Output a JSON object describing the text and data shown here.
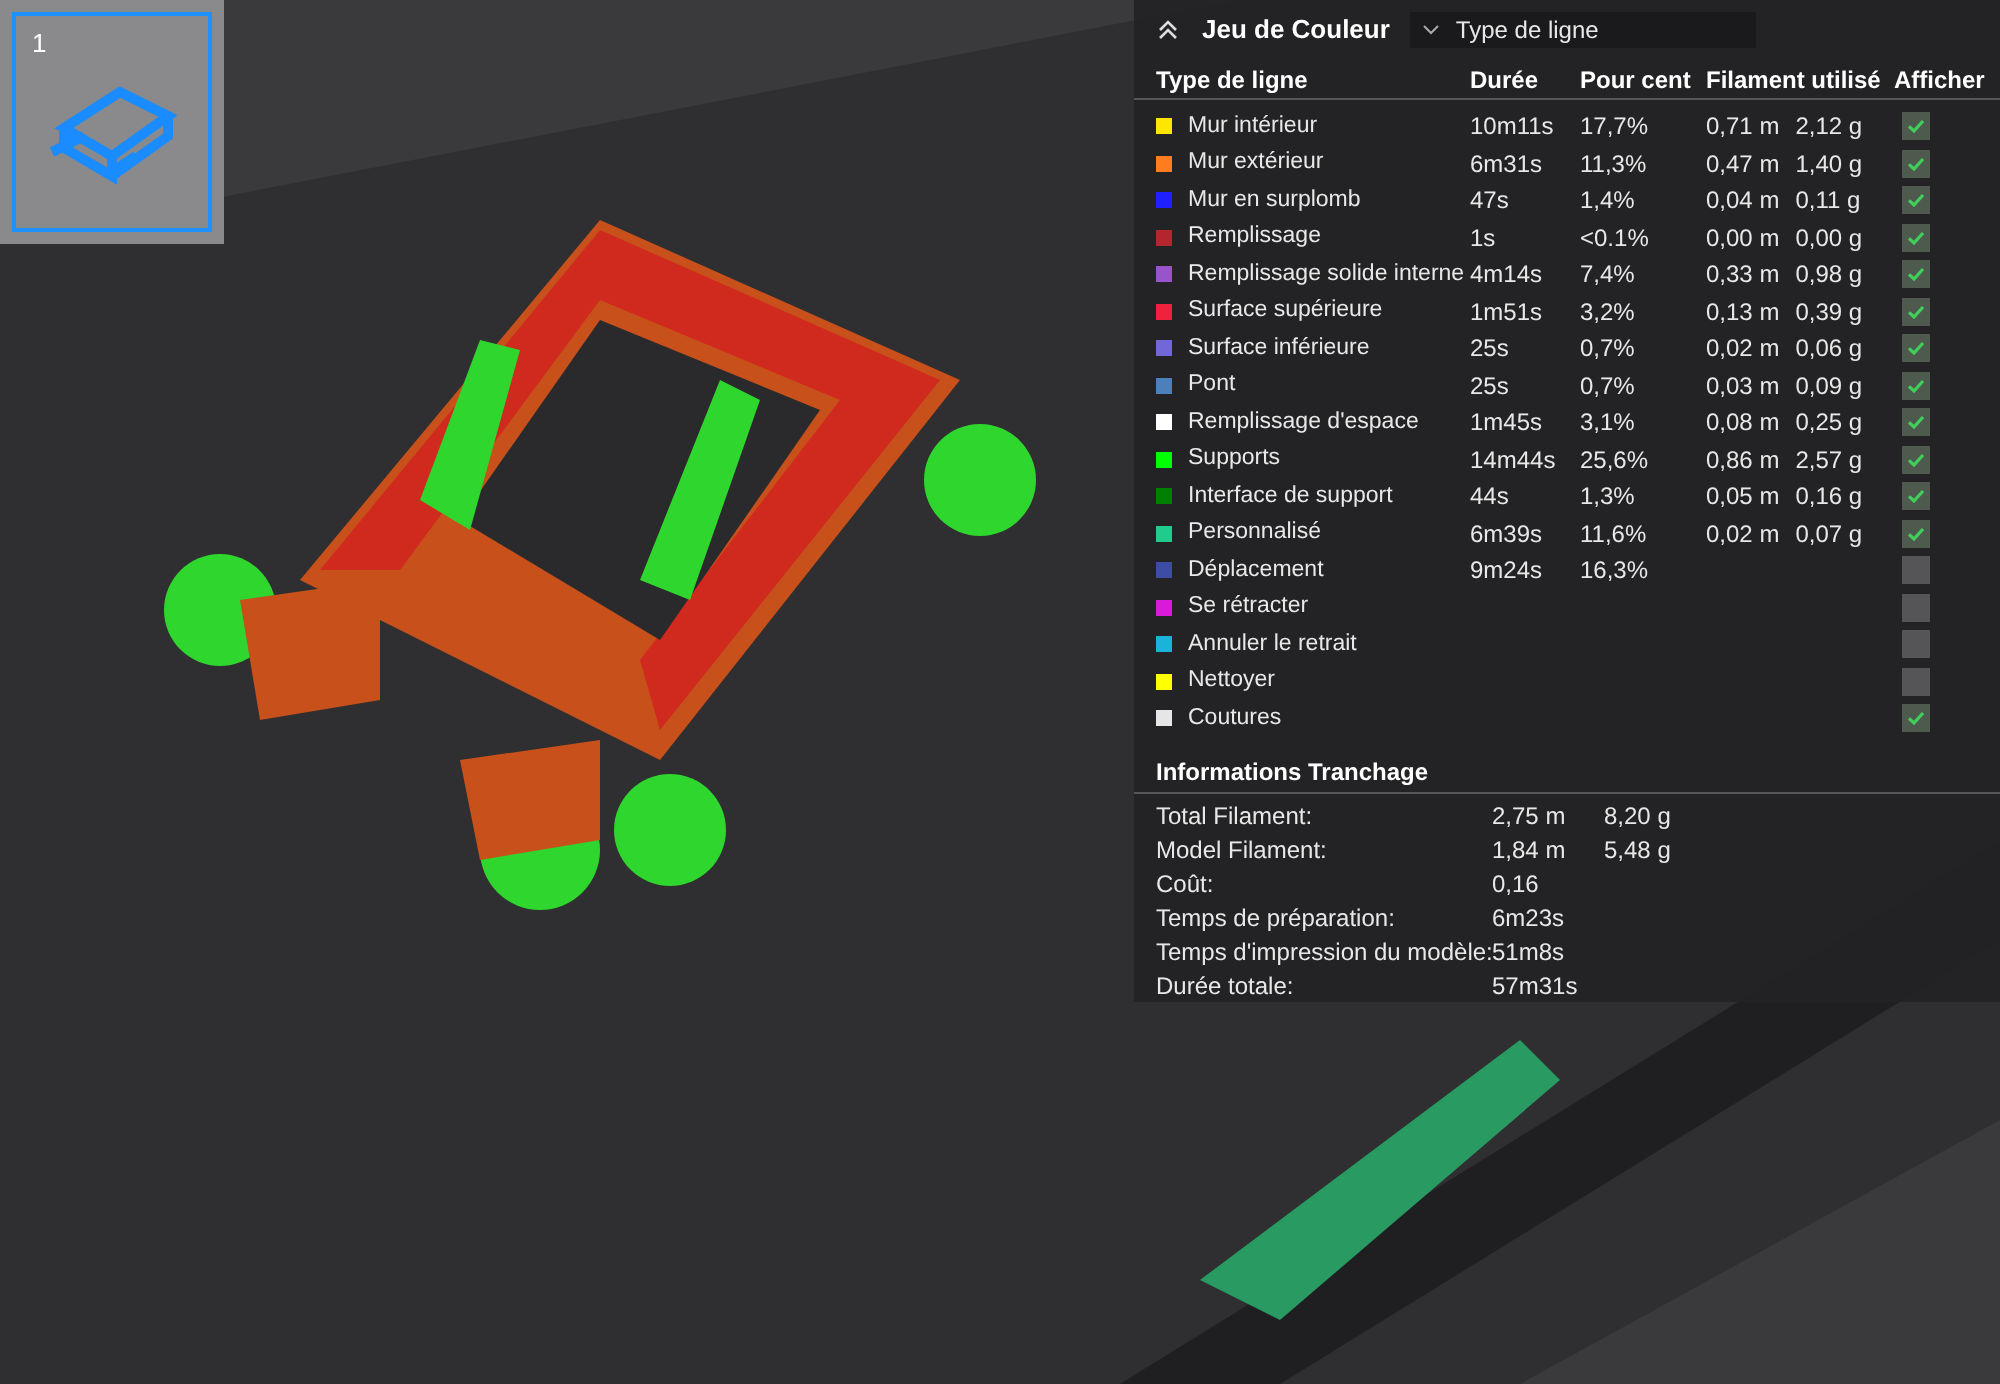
{
  "plate_thumbnail": {
    "label": "1",
    "selected": true
  },
  "legend": {
    "title": "Jeu de Couleur",
    "expanded": true,
    "view_select": {
      "value": "Type de ligne"
    },
    "columns": [
      "Type de ligne",
      "Durée",
      "Pour cent",
      "Filament utilisé",
      "Afficher"
    ],
    "rows": [
      {
        "name": "Mur intérieur",
        "color": "#ffe600",
        "duration": "10m11s",
        "percent": "17,7%",
        "length": "0,71 m",
        "weight": "2,12 g",
        "visible": true
      },
      {
        "name": "Mur extérieur",
        "color": "#ff7d1f",
        "duration": "6m31s",
        "percent": "11,3%",
        "length": "0,47 m",
        "weight": "1,40 g",
        "visible": true
      },
      {
        "name": "Mur en surplomb",
        "color": "#1f1fff",
        "duration": "47s",
        "percent": "1,4%",
        "length": "0,04 m",
        "weight": "0,11 g",
        "visible": true
      },
      {
        "name": "Remplissage",
        "color": "#b3262e",
        "duration": "1s",
        "percent": "<0.1%",
        "length": "0,00 m",
        "weight": "0,00 g",
        "visible": true
      },
      {
        "name": "Remplissage solide interne",
        "color": "#9954cc",
        "duration": "4m14s",
        "percent": "7,4%",
        "length": "0,33 m",
        "weight": "0,98 g",
        "visible": true
      },
      {
        "name": "Surface supérieure",
        "color": "#f0213d",
        "duration": "1m51s",
        "percent": "3,2%",
        "length": "0,13 m",
        "weight": "0,39 g",
        "visible": true
      },
      {
        "name": "Surface inférieure",
        "color": "#7366d9",
        "duration": "25s",
        "percent": "0,7%",
        "length": "0,02 m",
        "weight": "0,06 g",
        "visible": true
      },
      {
        "name": "Pont",
        "color": "#4d80ba",
        "duration": "25s",
        "percent": "0,7%",
        "length": "0,03 m",
        "weight": "0,09 g",
        "visible": true
      },
      {
        "name": "Remplissage d'espace",
        "color": "#ffffff",
        "duration": "1m45s",
        "percent": "3,1%",
        "length": "0,08 m",
        "weight": "0,25 g",
        "visible": true
      },
      {
        "name": "Supports",
        "color": "#00ff00",
        "duration": "14m44s",
        "percent": "25,6%",
        "length": "0,86 m",
        "weight": "2,57 g",
        "visible": true
      },
      {
        "name": "Interface de support",
        "color": "#008000",
        "duration": "44s",
        "percent": "1,3%",
        "length": "0,05 m",
        "weight": "0,16 g",
        "visible": true
      },
      {
        "name": "Personnalisé",
        "color": "#1fcc8c",
        "duration": "6m39s",
        "percent": "11,6%",
        "length": "0,02 m",
        "weight": "0,07 g",
        "visible": true
      },
      {
        "name": "Déplacement",
        "color": "#3d4da6",
        "duration": "9m24s",
        "percent": "16,3%",
        "visible": false
      },
      {
        "name": "Se rétracter",
        "color": "#d91ad9",
        "visible": false
      },
      {
        "name": "Annuler le retrait",
        "color": "#1ab3d9",
        "visible": false
      },
      {
        "name": "Nettoyer",
        "color": "#ffff00",
        "visible": false
      },
      {
        "name": "Coutures",
        "color": "#e6e6e6",
        "visible": true
      }
    ]
  },
  "slice_info": {
    "title": "Informations Tranchage",
    "rows": [
      {
        "label": "Total Filament:",
        "value": "2,75 m",
        "value_2": "8,20 g"
      },
      {
        "label": "Model Filament:",
        "value": "1,84 m",
        "value_2": "5,48 g"
      },
      {
        "label": "Coût:",
        "value": "0,16"
      },
      {
        "label": "Temps de préparation:",
        "value": "6m23s"
      },
      {
        "label": "Temps d'impression du modèle:",
        "value": "51m8s"
      },
      {
        "label": "Durée totale:",
        "value": "57m31s"
      }
    ]
  }
}
